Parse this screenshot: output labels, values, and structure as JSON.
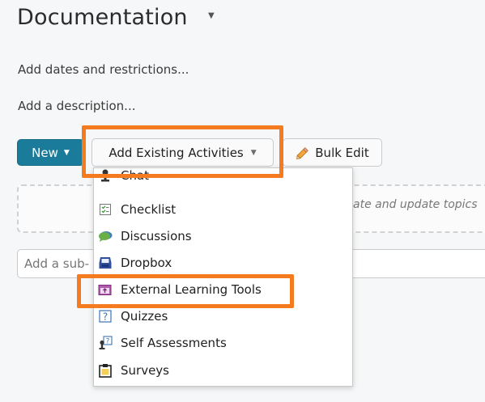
{
  "page": {
    "title": "Documentation",
    "add_dates": "Add dates and restrictions...",
    "add_description": "Add a description...",
    "dash_hint": "ate and update topics",
    "subinput_placeholder": "Add a sub-"
  },
  "toolbar": {
    "new_label": "New",
    "add_existing_label": "Add Existing Activities",
    "bulk_edit_label": "Bulk Edit"
  },
  "menu": {
    "items": [
      {
        "label": "Chat",
        "icon": "chat-icon"
      },
      {
        "label": "Checklist",
        "icon": "checklist-icon"
      },
      {
        "label": "Discussions",
        "icon": "discussions-icon"
      },
      {
        "label": "Dropbox",
        "icon": "dropbox-icon"
      },
      {
        "label": "External Learning Tools",
        "icon": "external-learning-tools-icon"
      },
      {
        "label": "Quizzes",
        "icon": "quizzes-icon"
      },
      {
        "label": "Self Assessments",
        "icon": "self-assessments-icon"
      },
      {
        "label": "Surveys",
        "icon": "surveys-icon"
      }
    ]
  },
  "highlights": {
    "color": "#f47b20"
  },
  "colors": {
    "primary_button": "#1a7c9a",
    "highlight": "#f47b20"
  }
}
